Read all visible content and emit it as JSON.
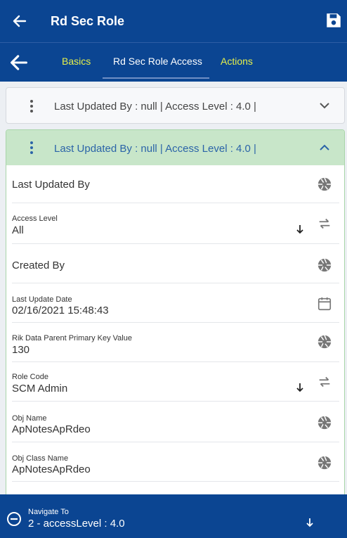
{
  "header": {
    "title": "Rd Sec Role"
  },
  "tabs": [
    {
      "label": "Basics"
    },
    {
      "label": "Rd Sec Role Access"
    },
    {
      "label": "Actions"
    }
  ],
  "cards": [
    {
      "summary": "Last Updated By  : null | Access Level  : 4.0 |"
    },
    {
      "summary": "Last Updated By  : null | Access Level  : 4.0 |"
    }
  ],
  "fields": {
    "last_updated_by": {
      "label": "Last Updated By"
    },
    "access_level": {
      "label": "Access Level",
      "value": "All"
    },
    "created_by": {
      "label": "Created By"
    },
    "last_update_date": {
      "label": "Last Update Date",
      "value": "02/16/2021 15:48:43"
    },
    "rik_parent_pk": {
      "label": "Rik Data Parent Primary Key Value",
      "value": "130"
    },
    "role_code": {
      "label": "Role Code",
      "value": "SCM Admin"
    },
    "obj_name": {
      "label": "Obj Name",
      "value": "ApNotesApRdeo"
    },
    "obj_class_name": {
      "label": "Obj Class Name",
      "value": "ApNotesApRdeo"
    }
  },
  "navigate": {
    "label": "Navigate To",
    "value": "2 - accessLevel : 4.0"
  },
  "colors": {
    "primary": "#0b4592",
    "tab_accent": "#e6f04a",
    "expanded_header": "#c8e6c9",
    "link_text": "#2b64a8"
  },
  "icons": [
    "back-arrow-icon",
    "save-icon",
    "kebab-menu-icon",
    "chevron-down-icon",
    "chevron-up-icon",
    "camera-shutter-icon",
    "swap-arrows-icon",
    "arrow-down-icon",
    "calendar-icon",
    "minus-circle-icon"
  ]
}
